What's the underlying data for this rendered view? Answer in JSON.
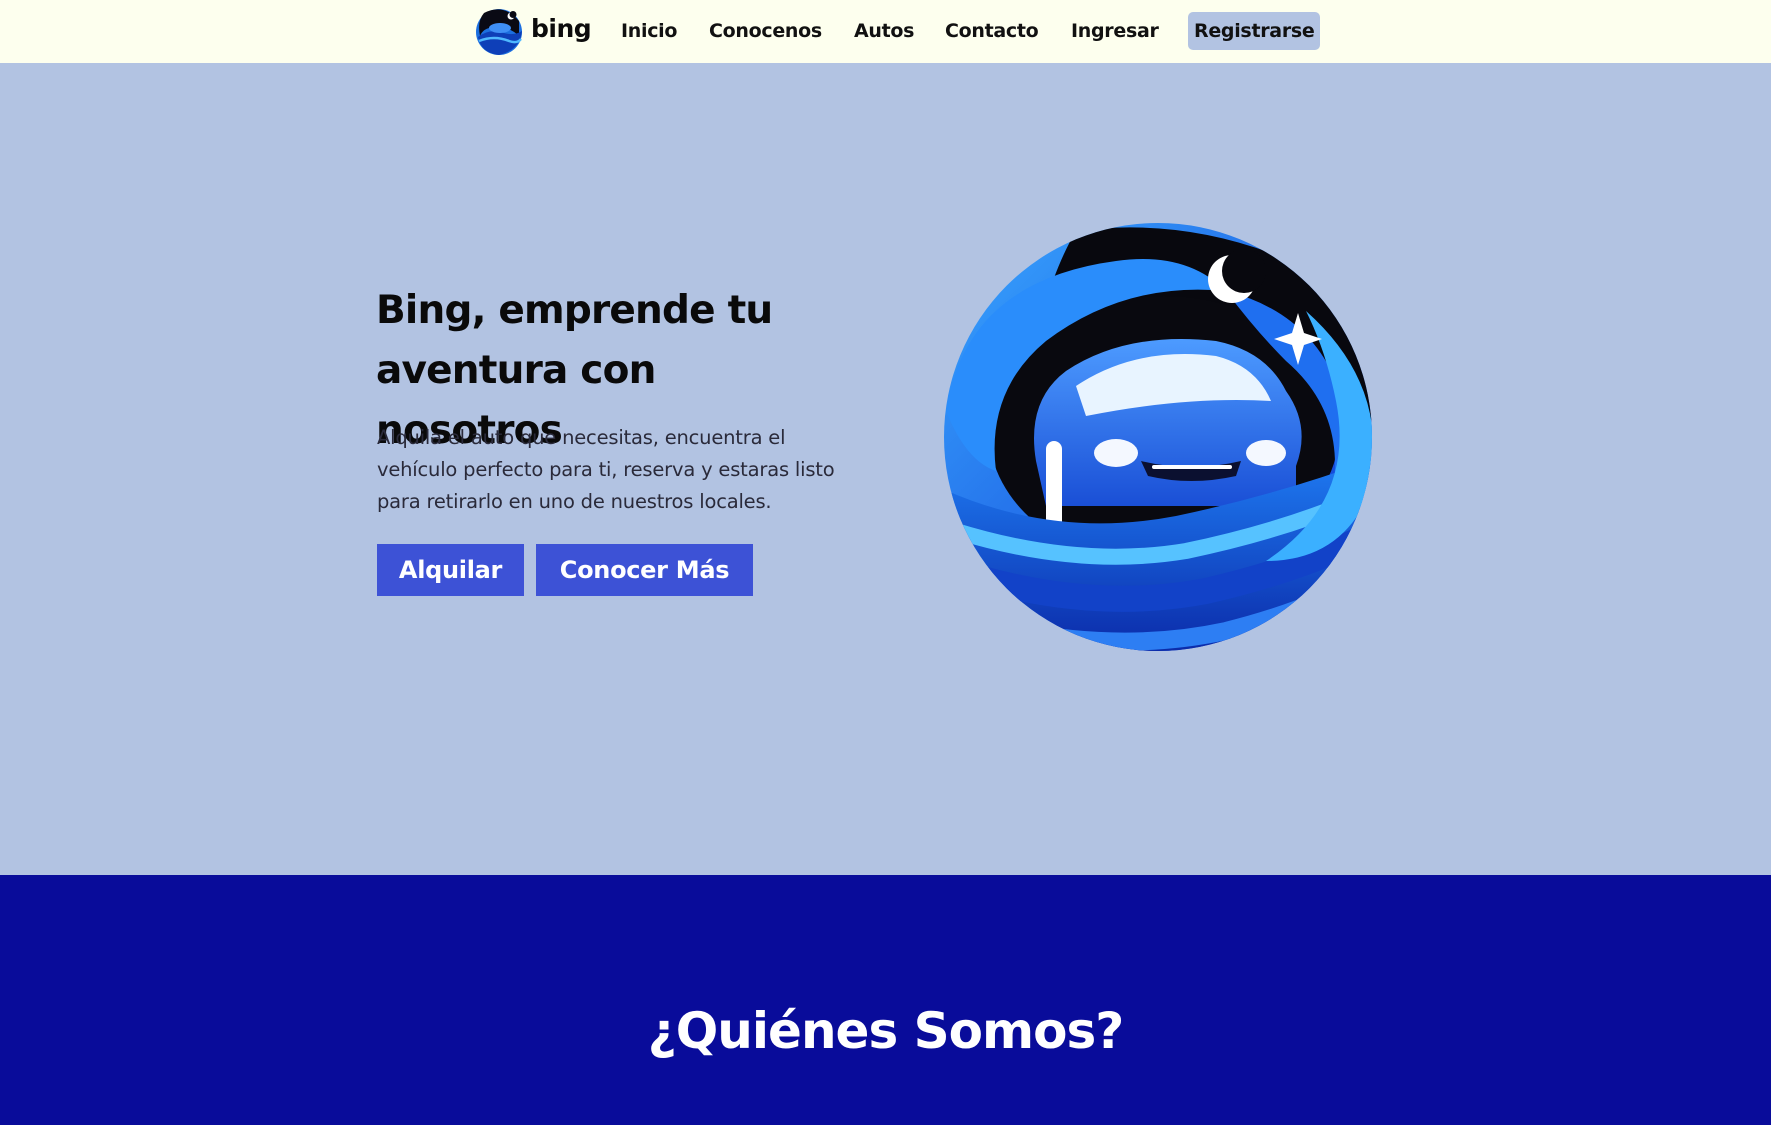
{
  "brand": {
    "name": "bing",
    "logo_icon": "car-wave-moon-logo"
  },
  "nav": {
    "items": [
      {
        "label": "Inicio"
      },
      {
        "label": "Conocenos"
      },
      {
        "label": "Autos"
      },
      {
        "label": "Contacto"
      },
      {
        "label": "Ingresar"
      },
      {
        "label": "Registrarse",
        "highlighted": true
      }
    ]
  },
  "hero": {
    "title": "Bing, emprende tu aventura con nosotros",
    "text": "Alquila el auto que necesitas, encuentra el vehículo perfecto para ti, reserva y estaras listo para retirarlo en uno de nuestros locales.",
    "primary_button": "Alquilar",
    "secondary_button": "Conocer Más",
    "illustration": "car-wave-moon-logo"
  },
  "about": {
    "title": "¿Quiénes Somos?"
  },
  "colors": {
    "navbar_bg": "#fdffee",
    "hero_bg": "#b2c3e2",
    "button_bg": "#3d52d6",
    "about_bg": "#090c9a"
  }
}
